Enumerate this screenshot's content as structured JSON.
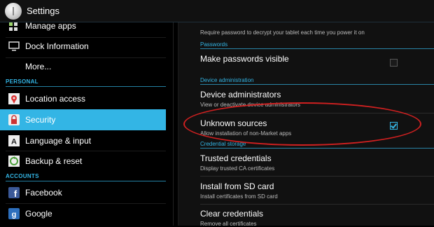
{
  "titlebar": {
    "title": "Settings",
    "icon": "settings-icon"
  },
  "sidebar": {
    "items": [
      {
        "label": "Manage apps",
        "icon": "apps-icon"
      },
      {
        "label": "Dock Information",
        "icon": "monitor-icon"
      },
      {
        "label": "More...",
        "icon": ""
      },
      {
        "label": "Location access",
        "icon": "location-icon"
      },
      {
        "label": "Security",
        "icon": "lock-icon",
        "active": true
      },
      {
        "label": "Language & input",
        "icon": "keyboard-icon"
      },
      {
        "label": "Backup & reset",
        "icon": "backup-icon"
      },
      {
        "label": "Facebook",
        "icon": "facebook-icon"
      },
      {
        "label": "Google",
        "icon": "google-icon"
      }
    ],
    "sections": {
      "personal": "PERSONAL",
      "accounts": "ACCOUNTS"
    }
  },
  "content": {
    "top_summary": "Require password to decrypt your tablet each time you power it on",
    "sections": {
      "passwords": "Passwords",
      "device_admin": "Device administration",
      "credential_storage": "Credential storage"
    },
    "prefs": {
      "make_passwords_visible": {
        "title": "Make passwords visible",
        "checked": false
      },
      "device_administrators": {
        "title": "Device administrators",
        "summary": "View or deactivate device administrators"
      },
      "unknown_sources": {
        "title": "Unknown sources",
        "summary": "Allow installation of non-Market apps",
        "checked": true
      },
      "trusted_credentials": {
        "title": "Trusted credentials",
        "summary": "Display trusted CA certificates"
      },
      "install_from_sd": {
        "title": "Install from SD card",
        "summary": "Install certificates from SD card"
      },
      "clear_credentials": {
        "title": "Clear credentials",
        "summary": "Remove all certificates"
      }
    }
  },
  "colors": {
    "accent": "#33b5e5",
    "highlight": "#d02020",
    "background": "#000000"
  }
}
